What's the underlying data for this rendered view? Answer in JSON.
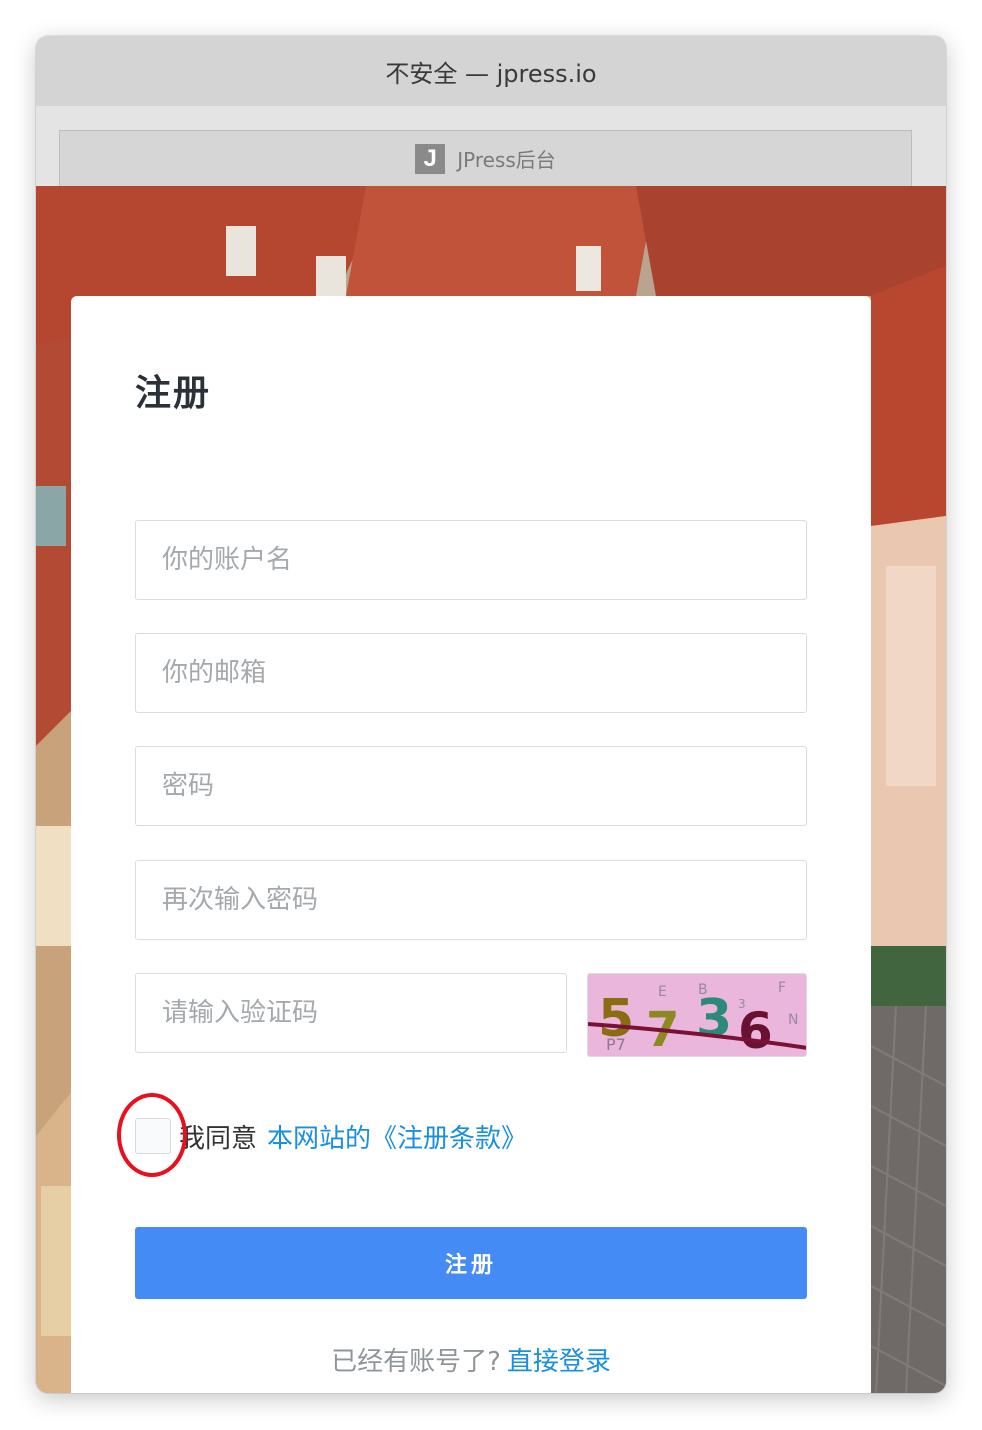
{
  "window": {
    "title": "不安全 — jpress.io",
    "tab": {
      "favicon_letter": "J",
      "label": "JPress后台"
    }
  },
  "form": {
    "title": "注册",
    "username_placeholder": "你的账户名",
    "email_placeholder": "你的邮箱",
    "password_placeholder": "密码",
    "confirm_password_placeholder": "再次输入密码",
    "captcha_placeholder": "请输入验证码",
    "captcha_text": "5736",
    "agree_text": "我同意",
    "terms_link": "本网站的《注册条款》",
    "submit_label": "注册",
    "login_question": "已经有账号了?",
    "login_link": "直接登录"
  },
  "colors": {
    "primary_button": "#448bf5",
    "link": "#1a8fe0",
    "highlight": "#e8101e"
  }
}
